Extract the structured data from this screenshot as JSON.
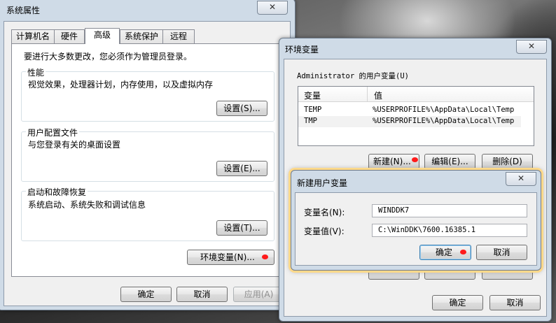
{
  "sysprops": {
    "title": "系统属性",
    "close": "✕",
    "tabs": [
      "计算机名",
      "硬件",
      "高级",
      "系统保护",
      "远程"
    ],
    "admin_note": "要进行大多数更改，您必须作为管理员登录。",
    "performance": {
      "title": "性能",
      "desc": "视觉效果，处理器计划，内存使用，以及虚拟内存",
      "button": "设置(S)..."
    },
    "profiles": {
      "title": "用户配置文件",
      "desc": "与您登录有关的桌面设置",
      "button": "设置(E)..."
    },
    "startup": {
      "title": "启动和故障恢复",
      "desc": "系统启动、系统失败和调试信息",
      "button": "设置(T)..."
    },
    "env_button": "环境变量(N)...",
    "ok": "确定",
    "cancel": "取消",
    "apply": "应用(A)"
  },
  "envvars": {
    "title": "环境变量",
    "close": "✕",
    "user_group": "Administrator 的用户变量(U)",
    "headers": [
      "变量",
      "值"
    ],
    "rows": [
      {
        "name": "TEMP",
        "value": "%USERPROFILE%\\AppData\\Local\\Temp"
      },
      {
        "name": "TMP",
        "value": "%USERPROFILE%\\AppData\\Local\\Temp"
      }
    ],
    "new": "新建(N)...",
    "edit": "编辑(E)...",
    "delete": "删除(D)",
    "ok": "确定",
    "cancel": "取消"
  },
  "newvar": {
    "title": "新建用户变量",
    "close": "✕",
    "name_label": "变量名(N):",
    "name_value": "WINDDK7",
    "value_label": "变量值(V):",
    "value_value": "C:\\WinDDK\\7600.16385.1",
    "ok": "确定",
    "cancel": "取消"
  },
  "colors": {
    "marker": "#ff1a1a",
    "accent": "#3c7fb1"
  }
}
